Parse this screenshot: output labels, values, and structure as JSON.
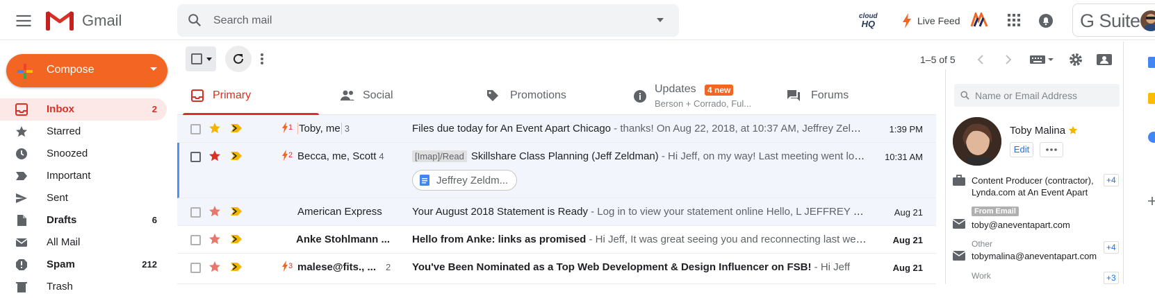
{
  "app": {
    "name": "Gmail"
  },
  "search": {
    "placeholder": "Search mail"
  },
  "header": {
    "cloudhq_line1": "cloud",
    "cloudhq_line2": "HQ",
    "live_feed": "Live Feed",
    "gsuite": "G Suite"
  },
  "compose": {
    "label": "Compose"
  },
  "sidebar": {
    "items": [
      {
        "label": "Inbox",
        "count": "2",
        "icon": "inbox-icon",
        "active": true
      },
      {
        "label": "Starred",
        "count": "",
        "icon": "star-icon"
      },
      {
        "label": "Snoozed",
        "count": "",
        "icon": "clock-icon"
      },
      {
        "label": "Important",
        "count": "",
        "icon": "important-icon"
      },
      {
        "label": "Sent",
        "count": "",
        "icon": "send-icon"
      },
      {
        "label": "Drafts",
        "count": "6",
        "icon": "draft-icon",
        "bold": true
      },
      {
        "label": "All Mail",
        "count": "",
        "icon": "mail-icon"
      },
      {
        "label": "Spam",
        "count": "212",
        "icon": "spam-icon",
        "bold": true
      },
      {
        "label": "Trash",
        "count": "",
        "icon": "trash-icon"
      }
    ]
  },
  "toolbar": {
    "pager": "1–5 of 5"
  },
  "tabs": [
    {
      "label": "Primary",
      "icon": "inbox-icon",
      "active": true
    },
    {
      "label": "Social",
      "icon": "people-icon"
    },
    {
      "label": "Promotions",
      "icon": "tag-icon"
    },
    {
      "label": "Updates",
      "icon": "info-icon",
      "badge": "4 new",
      "subtitle": "Berson + Corrado, Ful..."
    },
    {
      "label": "Forums",
      "icon": "forum-icon"
    }
  ],
  "messages": [
    {
      "marker": "1",
      "sender": "Toby, me",
      "count": "3",
      "starred": true,
      "star_color": "#f4b400",
      "label": "",
      "subject": "Files due today for An Event Apart Chicago",
      "snippet": " - thanks! On Aug 22, 2018, at 10:37 AM, Jeffrey Zeldman wrote:",
      "date": "1:39 PM",
      "unread": false
    },
    {
      "marker": "2",
      "sender": "Becca, me, Scott",
      "count": "4",
      "starred": true,
      "star_color": "#d93025",
      "label": "[Imap]/Read",
      "subject": "Skillshare Class Planning (Jeff Zeldman)",
      "snippet": " - Hi Jeff, on my way! Last meeting went long.",
      "date": "10:31 AM",
      "unread": false,
      "attachment": "Jeffrey Zeldm..."
    },
    {
      "marker": "",
      "sender": "American Express",
      "count": "",
      "starred": false,
      "label": "",
      "subject": "Your August 2018 Statement is Ready",
      "snippet": " - Log in to view your statement online Hello, L JEFFREY ZELDMAN",
      "date": "Aug 21",
      "unread": false
    },
    {
      "marker": "",
      "sender": "Anke Stohlmann ...",
      "count": "",
      "starred": false,
      "label": "",
      "subject": "Hello from Anke: links as promised",
      "snippet": " - Hi Jeff, It was great seeing you and reconnecting last week.",
      "date": "Aug 21",
      "unread": true
    },
    {
      "marker": "3",
      "sender": "malese@fits., ...",
      "count": "2",
      "starred": false,
      "label": "",
      "subject": "You've Been Nominated as a Top Web Development & Design Influencer on FSB!",
      "snippet": " - Hi Jeff",
      "date": "Aug 21",
      "unread": true
    }
  ],
  "contact_panel": {
    "search_placeholder": "Name or Email Address",
    "name": "Toby Malina",
    "edit": "Edit",
    "job_line1": "Content Producer (contractor),",
    "job_line2": "Lynda.com at An Event Apart",
    "job_more": "+4",
    "from_email_badge": "From Email",
    "email1": "toby@aneventapart.com",
    "other_label": "Other",
    "email2": "tobymalina@aneventapart.com",
    "email2_more": "+4",
    "work_label": "Work",
    "work_more": "+3"
  },
  "colors": {
    "compose": "#f26522",
    "active": "#d93025",
    "accent_blue": "#1a73e8"
  }
}
